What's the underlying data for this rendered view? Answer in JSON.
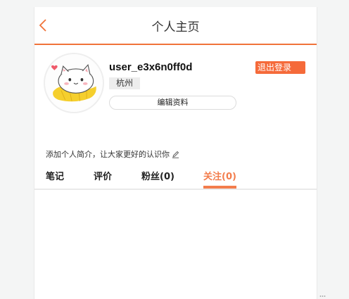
{
  "header": {
    "title": "个人主页",
    "back_icon": "chevron-left-icon"
  },
  "profile": {
    "username": "user_e3x6n0ff0d",
    "city": "杭州",
    "edit_button": "编辑资料",
    "logout_button": "退出登录",
    "bio_placeholder": "添加个人简介，让大家更好的认识你",
    "bio_icon": "pencil-icon",
    "avatar_icon": "cat-avatar-icon"
  },
  "tabs": [
    {
      "label": "笔记"
    },
    {
      "label": "评价"
    },
    {
      "label": "粉丝(0)"
    },
    {
      "label": "关注(0)"
    }
  ],
  "active_tab": "关注(0)",
  "colors": {
    "accent": "#f0733a",
    "logout_bg": "#f56a3a",
    "active_tab": "#f37d4c"
  }
}
